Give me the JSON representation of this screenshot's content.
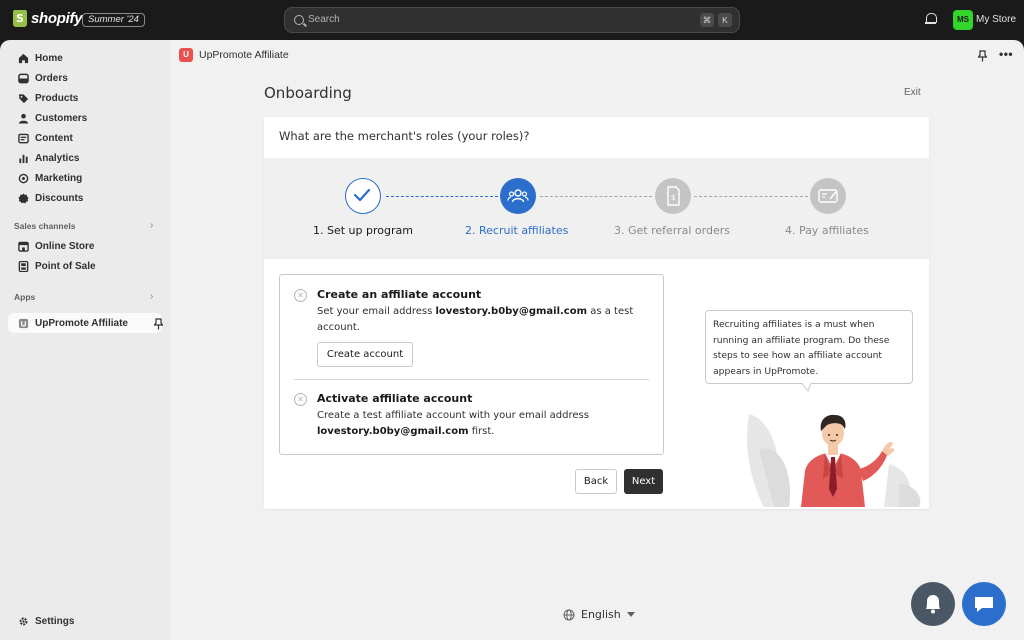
{
  "topbar": {
    "brand": "shopify",
    "edition_badge": "Summer '24",
    "search_placeholder": "Search",
    "shortcut_keys": [
      "⌘",
      "K"
    ],
    "avatar_initials": "MS",
    "store_name": "My Store"
  },
  "sidebar": {
    "items": [
      {
        "label": "Home",
        "icon": "home-icon"
      },
      {
        "label": "Orders",
        "icon": "orders-icon"
      },
      {
        "label": "Products",
        "icon": "tag-icon"
      },
      {
        "label": "Customers",
        "icon": "person-icon"
      },
      {
        "label": "Content",
        "icon": "content-icon"
      },
      {
        "label": "Analytics",
        "icon": "bar-chart-icon"
      },
      {
        "label": "Marketing",
        "icon": "target-icon"
      },
      {
        "label": "Discounts",
        "icon": "discount-icon"
      }
    ],
    "sales_channels_title": "Sales channels",
    "sales_channels": [
      {
        "label": "Online Store",
        "icon": "store-icon"
      },
      {
        "label": "Point of Sale",
        "icon": "pos-icon"
      }
    ],
    "apps_title": "Apps",
    "apps": [
      {
        "label": "UpPromote Affiliate",
        "icon": "app-icon"
      }
    ],
    "settings_label": "Settings"
  },
  "appbar": {
    "title": "UpPromote Affiliate"
  },
  "page": {
    "title": "Onboarding",
    "exit_label": "Exit",
    "question": "What are the merchant's roles (your roles)?",
    "steps": [
      {
        "label": "1. Set up program",
        "state": "done"
      },
      {
        "label": "2. Recruit affiliates",
        "state": "current"
      },
      {
        "label": "3. Get referral orders",
        "state": "pending"
      },
      {
        "label": "4. Pay affiliates",
        "state": "pending"
      }
    ],
    "task1": {
      "title": "Create an affiliate account",
      "desc_prefix": "Set your email address ",
      "email": "lovestory.b0by@gmail.com",
      "desc_suffix": " as a test account.",
      "button": "Create account"
    },
    "task2": {
      "title": "Activate affiliate account",
      "desc_prefix": "Create a test affiliate account with your email address ",
      "email": "lovestory.b0by@gmail.com",
      "desc_suffix": " first."
    },
    "back_label": "Back",
    "next_label": "Next",
    "tip": "Recruiting affiliates is a must when running an affiliate program. Do these steps to see how an affiliate account appears in UpPromote."
  },
  "footer": {
    "language": "English"
  },
  "colors": {
    "accent_blue": "#2c6ecb",
    "step_pending": "#c4c4c4",
    "primary_button": "#303030",
    "fab_gray": "#4a5764",
    "fab_blue": "#2c6ecb"
  }
}
